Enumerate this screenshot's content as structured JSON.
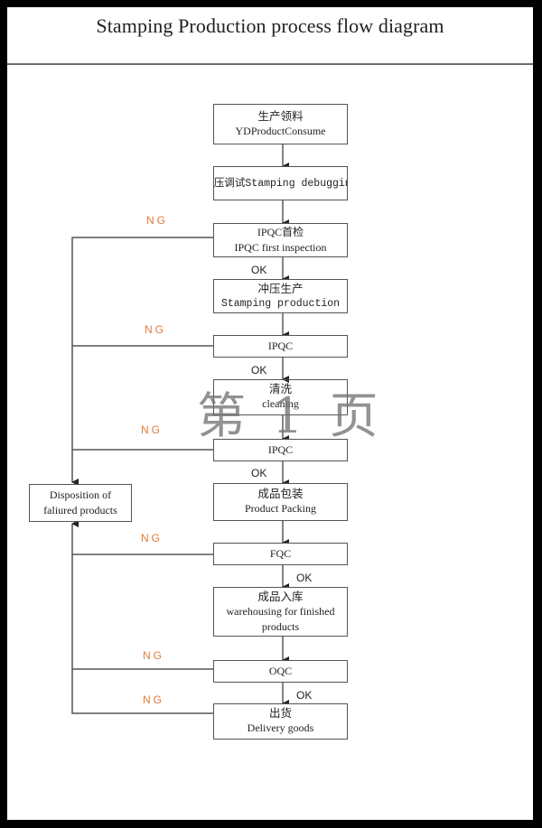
{
  "title": "Stamping Production process flow diagram",
  "steps": [
    {
      "cn": "生产领料",
      "en": "YDProductConsume"
    },
    {
      "text": "冲压调试Stamping debugging"
    },
    {
      "cn": "IPQC首检",
      "en": "IPQC first inspection"
    },
    {
      "cn": "冲压生产",
      "en": "Stamping production"
    },
    {
      "text": "IPQC"
    },
    {
      "cn": "清洗",
      "en": "cleaning"
    },
    {
      "text": "IPQC"
    },
    {
      "cn": "成品包装",
      "en": "Product Packing"
    },
    {
      "text": "FQC"
    },
    {
      "cn": "成品入库",
      "en": "warehousing  for finished",
      "en2": "products"
    },
    {
      "text": "OQC"
    },
    {
      "cn": "出货",
      "en": "Delivery goods"
    }
  ],
  "disposition": {
    "line1": "Disposition of",
    "line2": "faliured products"
  },
  "labels": {
    "ng": "NG",
    "ok": "OK"
  },
  "watermark": "第 1 页",
  "colors": {
    "ng": "#e07b39",
    "line": "#555555"
  }
}
